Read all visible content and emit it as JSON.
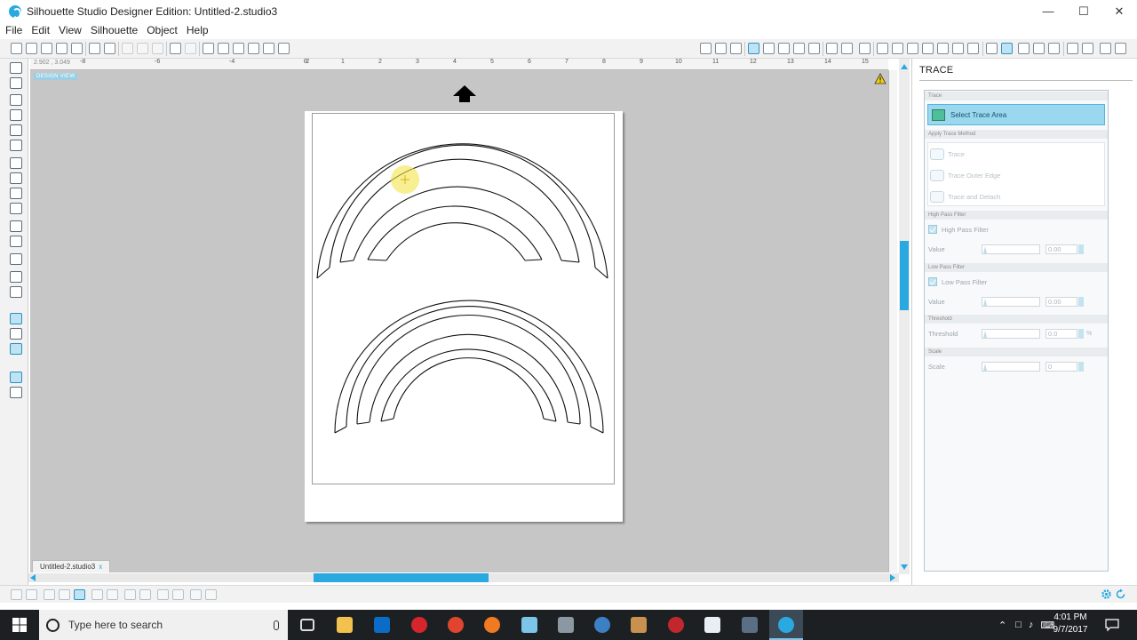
{
  "window": {
    "title": "Silhouette Studio Designer Edition: Untitled-2.studio3",
    "minimize": "—",
    "maximize": "☐",
    "close": "✕"
  },
  "menu": [
    "File",
    "Edit",
    "View",
    "Silhouette",
    "Object",
    "Help"
  ],
  "canvas": {
    "design_view_label": "DESIGN VIEW",
    "cursor_coords": "2.902 , 3.049",
    "ruler_numbers": [
      "-8",
      "-6",
      "-4",
      "-2",
      "0",
      "1",
      "2",
      "3",
      "4",
      "5",
      "6",
      "7",
      "8",
      "9",
      "10",
      "11",
      "12",
      "13",
      "14",
      "15"
    ]
  },
  "document_tab": {
    "name": "Untitled-2.studio3",
    "close": "x"
  },
  "panel": {
    "title": "TRACE",
    "trace_section": "Trace",
    "select_trace_area": "Select Trace Area",
    "apply_method_section": "Apply Trace Method",
    "methods": [
      "Trace",
      "Trace Outer Edge",
      "Trace and Detach"
    ],
    "high_pass_section": "High Pass Filter",
    "high_pass_label": "High Pass Filter",
    "high_pass_value_label": "Value",
    "high_pass_value": "0.00",
    "low_pass_section": "Low Pass Filter",
    "low_pass_label": "Low Pass Filter",
    "low_pass_value_label": "Value",
    "low_pass_value": "0.00",
    "threshold_section": "Threshold",
    "threshold_label": "Threshold",
    "threshold_value": "0.0",
    "threshold_unit": "%",
    "scale_section": "Scale",
    "scale_label": "Scale",
    "scale_value": "0"
  },
  "taskbar": {
    "search_placeholder": "Type here to search",
    "time": "4:01 PM",
    "date": "9/7/2017"
  },
  "colors": {
    "accent": "#29a9e0",
    "canvas_bg": "#c6c6c6",
    "taskbar": "#1d2023"
  }
}
